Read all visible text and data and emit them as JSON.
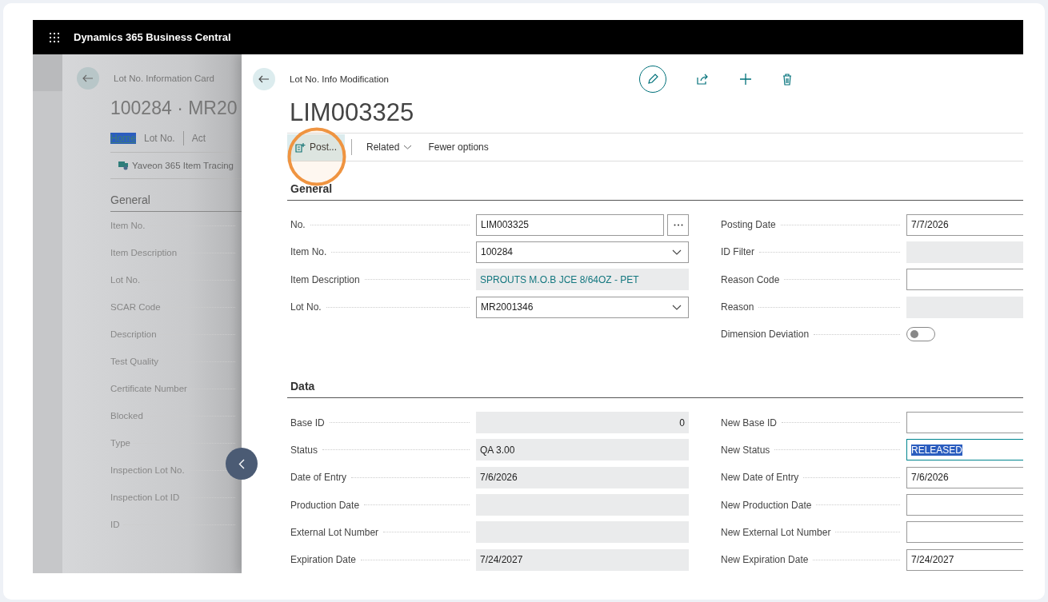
{
  "app": {
    "title": "Dynamics 365 Business Central"
  },
  "background_page": {
    "breadcrumb": "Lot No. Information Card",
    "title": "100284 · MR20",
    "tabs": [
      {
        "label": "Home",
        "selected": true
      },
      {
        "label": "Lot No.",
        "selected": false
      },
      {
        "label": "Act",
        "selected": false
      }
    ],
    "action": "Yaveon 365 Item Tracing",
    "section": "General",
    "fields": [
      "Item No.",
      "Item Description",
      "Lot No.",
      "SCAR Code",
      "Description",
      "Test Quality",
      "Certificate Number",
      "Blocked",
      "Type",
      "Inspection Lot No.",
      "Inspection Lot ID",
      "ID"
    ]
  },
  "page": {
    "breadcrumb": "Lot No. Info Modification",
    "title": "LIM003325",
    "actions": [
      {
        "label": "Post...",
        "kind": "post",
        "active": true
      },
      {
        "label": "Related",
        "kind": "menu",
        "active": false
      },
      {
        "label": "Fewer options",
        "kind": "plain",
        "active": false
      }
    ],
    "sections": [
      {
        "title": "General",
        "left": [
          {
            "label": "No.",
            "kind": "lookup",
            "value": "LIM003325"
          },
          {
            "label": "Item No.",
            "kind": "dropdown",
            "value": "100284"
          },
          {
            "label": "Item Description",
            "kind": "readonly",
            "value": "SPROUTS M.O.B JCE 8/64OZ - PET",
            "link": true
          },
          {
            "label": "Lot No.",
            "kind": "dropdown",
            "value": "MR2001346"
          }
        ],
        "right": [
          {
            "label": "Posting Date",
            "kind": "input",
            "value": "7/7/2026"
          },
          {
            "label": "ID Filter",
            "kind": "readonly"
          },
          {
            "label": "Reason Code",
            "kind": "input"
          },
          {
            "label": "Reason",
            "kind": "readonly"
          },
          {
            "label": "Dimension Deviation",
            "kind": "toggle",
            "on": false
          }
        ]
      },
      {
        "title": "Data",
        "left": [
          {
            "label": "Base ID",
            "kind": "readonly",
            "value": "0",
            "numeric": true
          },
          {
            "label": "Status",
            "kind": "readonly",
            "value": "QA 3.00"
          },
          {
            "label": "Date of Entry",
            "kind": "readonly",
            "value": "7/6/2026"
          },
          {
            "label": "Production Date",
            "kind": "readonly"
          },
          {
            "label": "External Lot Number",
            "kind": "readonly"
          },
          {
            "label": "Expiration Date",
            "kind": "readonly",
            "value": "7/24/2027"
          }
        ],
        "right": [
          {
            "label": "New Base ID",
            "kind": "input"
          },
          {
            "label": "New Status",
            "kind": "input",
            "value": "RELEASED",
            "selected": true
          },
          {
            "label": "New Date of Entry",
            "kind": "input",
            "value": "7/6/2026"
          },
          {
            "label": "New Production Date",
            "kind": "input"
          },
          {
            "label": "New External Lot Number",
            "kind": "input"
          },
          {
            "label": "New Expiration Date",
            "kind": "input",
            "value": "7/24/2027"
          }
        ]
      }
    ]
  }
}
